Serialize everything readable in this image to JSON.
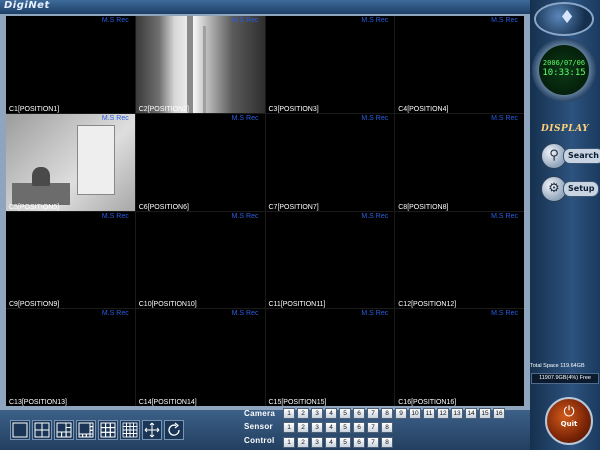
{
  "app": {
    "title": "DigiNet"
  },
  "clock": {
    "date": "2006/07/06",
    "time": "10:33:15"
  },
  "panel": {
    "display_label": "DISPLAY",
    "search_label": "Search",
    "setup_label": "Setup",
    "quit_label": "Quit"
  },
  "storage": {
    "total_label": "Total Space 119.64GB",
    "free_label": "11907.9GB(4%) Free"
  },
  "cameras": [
    {
      "label": "C1[POSITION1]",
      "rec": "M.S Rec"
    },
    {
      "label": "C2[POSITION2]",
      "rec": "M.S Rec"
    },
    {
      "label": "C3[POSITION3]",
      "rec": "M.S Rec"
    },
    {
      "label": "C4[POSITION4]",
      "rec": "M.S Rec"
    },
    {
      "label": "C5[POSITION5]",
      "rec": "M.S Rec"
    },
    {
      "label": "C6[POSITION6]",
      "rec": "M.S Rec"
    },
    {
      "label": "C7[POSITION7]",
      "rec": "M.S Rec"
    },
    {
      "label": "C8[POSITION8]",
      "rec": "M.S Rec"
    },
    {
      "label": "C9[POSITION9]",
      "rec": "M.S Rec"
    },
    {
      "label": "C10[POSITION10]",
      "rec": "M.S Rec"
    },
    {
      "label": "C11[POSITION11]",
      "rec": "M.S Rec"
    },
    {
      "label": "C12[POSITION12]",
      "rec": "M.S Rec"
    },
    {
      "label": "C13[POSITION13]",
      "rec": "M.S Rec"
    },
    {
      "label": "C14[POSITION14]",
      "rec": "M.S Rec"
    },
    {
      "label": "C15[POSITION15]",
      "rec": "M.S Rec"
    },
    {
      "label": "C16[POSITION16]",
      "rec": "M.S Rec"
    }
  ],
  "selected_camera": 5,
  "strips": {
    "camera": {
      "label": "Camera",
      "buttons": [
        "1",
        "2",
        "3",
        "4",
        "5",
        "6",
        "7",
        "8",
        "9",
        "10",
        "11",
        "12",
        "13",
        "14",
        "15",
        "16"
      ]
    },
    "sensor": {
      "label": "Sensor",
      "buttons": [
        "1",
        "2",
        "3",
        "4",
        "5",
        "6",
        "7",
        "8"
      ]
    },
    "control": {
      "label": "Control",
      "buttons": [
        "1",
        "2",
        "3",
        "4",
        "5",
        "6",
        "7",
        "8"
      ]
    }
  },
  "split_buttons": [
    "single-view-icon",
    "quad-view-icon",
    "six-view-icon",
    "eight-view-icon",
    "nine-view-icon",
    "sixteen-view-icon",
    "ptz-move-icon",
    "rotate-icon"
  ],
  "colors": {
    "rec": "#2a5fe0",
    "clock": "#5cff6a",
    "display": "#ffd27a",
    "quit": "#d15a1a"
  }
}
